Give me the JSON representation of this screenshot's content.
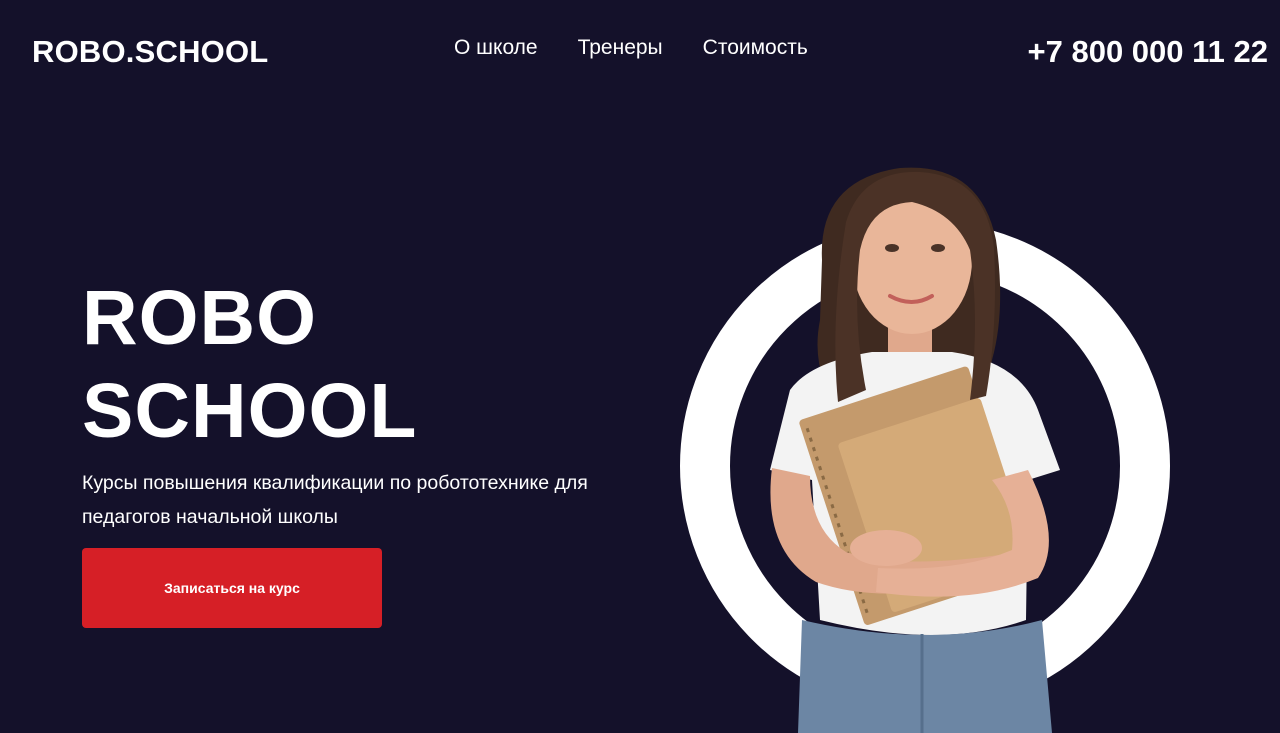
{
  "header": {
    "logo": "ROBO.SCHOOL",
    "nav": [
      {
        "label": "О школе"
      },
      {
        "label": "Тренеры"
      },
      {
        "label": "Стоимость"
      }
    ],
    "phone": "+7 800 000 11 22"
  },
  "hero": {
    "title_line1": "ROBO",
    "title_line2": "SCHOOL",
    "subtitle": "Курсы повышения квалификации по робототехнике для педагогов начальной школы",
    "cta_label": "Записаться на курс"
  },
  "colors": {
    "background": "#14112a",
    "accent": "#d61f26",
    "text": "#ffffff"
  },
  "icons": {
    "illustration": "student-with-notebooks"
  }
}
